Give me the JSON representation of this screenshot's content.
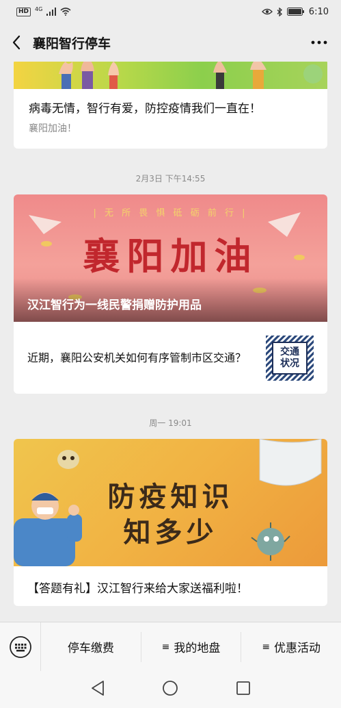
{
  "status_bar": {
    "hd": "HD",
    "network": "4G",
    "time": "6:10"
  },
  "navbar": {
    "title": "襄阳智行停车"
  },
  "feed": {
    "card1": {
      "title": "病毒无情，智行有爱，防控疫情我们一直在！",
      "subtitle": "襄阳加油！"
    },
    "time1": "2月3日 下午14:55",
    "card2": {
      "banner_slogan": "| 无 所 畏 惧   砥 砺 前 行 |",
      "banner_big": "襄阳加油",
      "title": "汉江智行为一线民警捐赠防护用品",
      "sub_text": "近期，襄阳公安机关如何有序管制市区交通？",
      "thumb_line1": "交通",
      "thumb_line2": "状况"
    },
    "time2": "周一 19:01",
    "card3": {
      "banner_line1": "防疫知识",
      "banner_line2": "知多少",
      "title": "【答题有礼】汉江智行来给大家送福利啦！"
    }
  },
  "bottom_menu": {
    "items": [
      {
        "label": "停车缴费",
        "has_submenu": false
      },
      {
        "label": "我的地盘",
        "has_submenu": true
      },
      {
        "label": "优惠活动",
        "has_submenu": true
      }
    ]
  },
  "icons": {
    "back": "chevron-left-icon",
    "more": "more-dots-icon",
    "keyboard": "keyboard-icon",
    "nav_back": "triangle-back-icon",
    "nav_home": "circle-home-icon",
    "nav_recent": "square-recent-icon"
  }
}
